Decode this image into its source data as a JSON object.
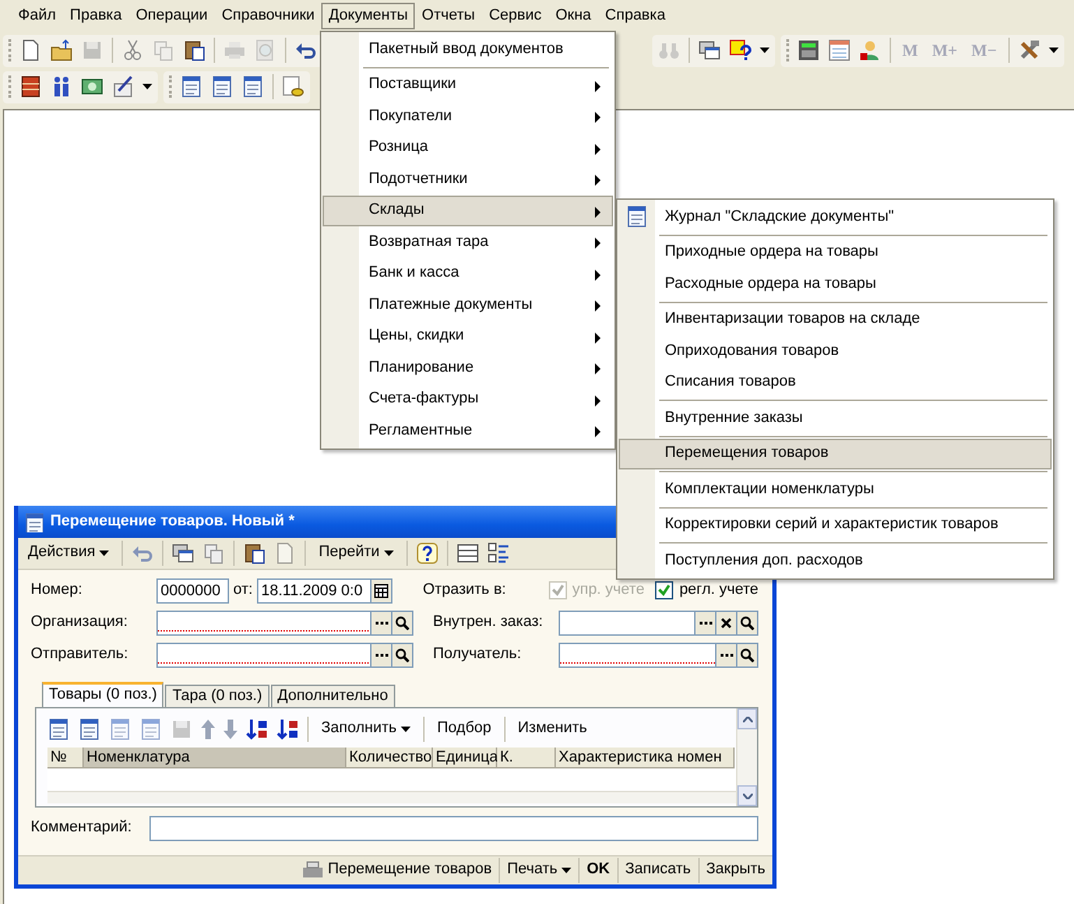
{
  "menubar": [
    {
      "label": "Файл",
      "selected": false
    },
    {
      "label": "Правка",
      "selected": false
    },
    {
      "label": "Операции",
      "selected": false
    },
    {
      "label": "Справочники",
      "selected": false
    },
    {
      "label": "Документы",
      "selected": true
    },
    {
      "label": "Отчеты",
      "selected": false
    },
    {
      "label": "Сервис",
      "selected": false
    },
    {
      "label": "Окна",
      "selected": false
    },
    {
      "label": "Справка",
      "selected": false
    }
  ],
  "memory_buttons": [
    {
      "label": "M",
      "disabled": true
    },
    {
      "label": "M+",
      "disabled": true
    },
    {
      "label": "M−",
      "disabled": true
    }
  ],
  "documents_menu": [
    {
      "kind": "item",
      "label": "Пакетный ввод документов",
      "submenu": false,
      "selected": false
    },
    {
      "kind": "separator"
    },
    {
      "kind": "item",
      "label": "Поставщики",
      "submenu": true,
      "selected": false
    },
    {
      "kind": "item",
      "label": "Покупатели",
      "submenu": true,
      "selected": false
    },
    {
      "kind": "item",
      "label": "Розница",
      "submenu": true,
      "selected": false
    },
    {
      "kind": "item",
      "label": "Подотчетники",
      "submenu": true,
      "selected": false
    },
    {
      "kind": "item",
      "label": "Склады",
      "submenu": true,
      "selected": true
    },
    {
      "kind": "item",
      "label": "Возвратная тара",
      "submenu": true,
      "selected": false
    },
    {
      "kind": "item",
      "label": "Банк и касса",
      "submenu": true,
      "selected": false
    },
    {
      "kind": "item",
      "label": "Платежные документы",
      "submenu": true,
      "selected": false
    },
    {
      "kind": "item",
      "label": "Цены, скидки",
      "submenu": true,
      "selected": false
    },
    {
      "kind": "item",
      "label": "Планирование",
      "submenu": true,
      "selected": false
    },
    {
      "kind": "item",
      "label": "Счета-фактуры",
      "submenu": true,
      "selected": false
    },
    {
      "kind": "item",
      "label": "Регламентные",
      "submenu": true,
      "selected": false
    }
  ],
  "warehouse_submenu": [
    {
      "kind": "icon_item",
      "label": "Журнал \"Складские документы\"",
      "selected": false
    },
    {
      "kind": "separator"
    },
    {
      "kind": "item",
      "label": "Приходные ордера на товары",
      "selected": false
    },
    {
      "kind": "item",
      "label": "Расходные ордера на товары",
      "selected": false
    },
    {
      "kind": "separator"
    },
    {
      "kind": "item",
      "label": "Инвентаризации товаров на складе",
      "selected": false
    },
    {
      "kind": "item",
      "label": "Оприходования товаров",
      "selected": false
    },
    {
      "kind": "item",
      "label": "Списания товаров",
      "selected": false
    },
    {
      "kind": "separator"
    },
    {
      "kind": "item",
      "label": "Внутренние заказы",
      "selected": false
    },
    {
      "kind": "separator"
    },
    {
      "kind": "item",
      "label": "Перемещения товаров",
      "selected": true
    },
    {
      "kind": "separator"
    },
    {
      "kind": "item",
      "label": "Комплектации номенклатуры",
      "selected": false
    },
    {
      "kind": "separator"
    },
    {
      "kind": "item",
      "label": "Корректировки серий и характеристик товаров",
      "selected": false
    },
    {
      "kind": "separator"
    },
    {
      "kind": "item",
      "label": "Поступления доп. расходов",
      "selected": false
    }
  ],
  "form": {
    "title": "Перемещение товаров. Новый *",
    "toolbar": {
      "actions": "Действия",
      "goto": "Перейти"
    },
    "number": {
      "label": "Номер:",
      "value": "0000000"
    },
    "date": {
      "label": "от:",
      "value": "18.11.2009 0:0"
    },
    "reflect": {
      "label": "Отразить в:",
      "options": [
        {
          "label": "упр. учете",
          "checked": true,
          "disabled": true
        },
        {
          "label": "регл. учете",
          "checked": true,
          "disabled": false
        }
      ]
    },
    "fields": [
      {
        "label": "Организация:",
        "required": true,
        "clearable": false
      },
      {
        "label": "Внутрен. заказ:",
        "required": false,
        "clearable": true
      },
      {
        "label": "Отправитель:",
        "required": true,
        "clearable": false
      },
      {
        "label": "Получатель:",
        "required": true,
        "clearable": false
      }
    ],
    "tabs": [
      {
        "label": "Товары (0 поз.)",
        "selected": true
      },
      {
        "label": "Тара (0 поз.)",
        "selected": false
      },
      {
        "label": "Дополнительно",
        "selected": false
      }
    ],
    "table_toolbar": {
      "fill": "Заполнить",
      "pick": "Подбор",
      "edit": "Изменить"
    },
    "table": {
      "columns": [
        {
          "label": "№",
          "selected": false
        },
        {
          "label": "Номенклатура",
          "selected": true
        },
        {
          "label": "Количество",
          "selected": false
        },
        {
          "label": "Единица",
          "selected": false
        },
        {
          "label": "К.",
          "selected": false
        },
        {
          "label": "Характеристика номен",
          "selected": false
        }
      ]
    },
    "comment": {
      "label": "Комментарий:"
    },
    "footer": {
      "print_form": "Перемещение товаров",
      "print": "Печать",
      "ok": "OK",
      "save": "Записать",
      "close": "Закрыть"
    }
  }
}
